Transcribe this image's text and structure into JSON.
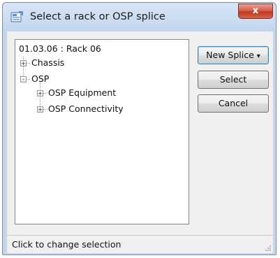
{
  "window": {
    "title": "Select a rack or OSP splice",
    "close_label": "x"
  },
  "tree": {
    "root": "01.03.06 : Rack 06",
    "items": [
      {
        "label": "Chassis",
        "expander": "+"
      },
      {
        "label": "OSP",
        "expander": "-"
      },
      {
        "label": "OSP Equipment",
        "expander": "+"
      },
      {
        "label": "OSP Connectivity",
        "expander": "+"
      }
    ]
  },
  "buttons": {
    "new_splice": "New Splice",
    "new_splice_arrow": "▾",
    "select": "Select",
    "cancel": "Cancel"
  },
  "status": {
    "text": "Click to change selection"
  },
  "colors": {
    "title_bar": "#c8daf0",
    "close_button": "#c2391f",
    "client_background": "#f0f0f0",
    "focus_border": "#3c7fb1"
  }
}
